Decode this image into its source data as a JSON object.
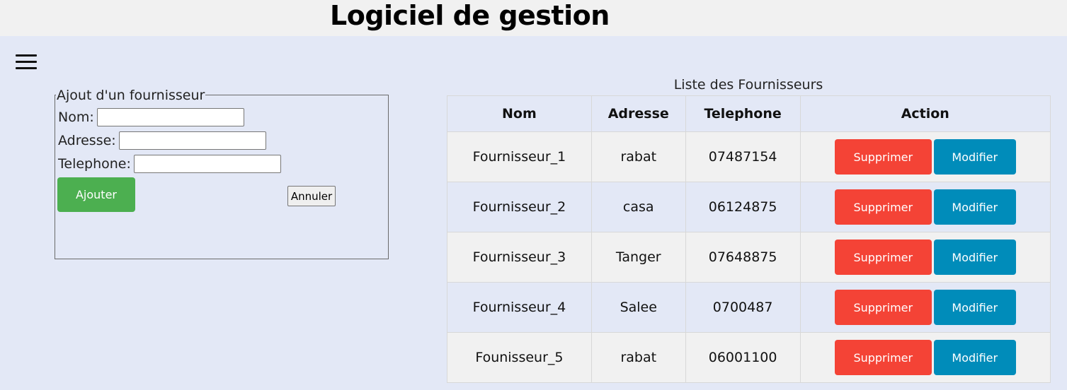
{
  "header": {
    "title": "Logiciel de gestion"
  },
  "menu": {
    "icon": "hamburger-menu-icon"
  },
  "form": {
    "legend": "Ajout d'un fournisseur",
    "fields": [
      {
        "label": "Nom:",
        "value": "",
        "placeholder": ""
      },
      {
        "label": "Adresse:",
        "value": "",
        "placeholder": ""
      },
      {
        "label": "Telephone:",
        "value": "",
        "placeholder": ""
      }
    ],
    "submit_label": "Ajouter",
    "cancel_label": "Annuler"
  },
  "table": {
    "caption": "Liste des Fournisseurs",
    "columns": [
      "Nom",
      "Adresse",
      "Telephone",
      "Action"
    ],
    "rows": [
      {
        "nom": "Fournisseur_1",
        "adresse": "rabat",
        "telephone": "07487154"
      },
      {
        "nom": "Fournisseur_2",
        "adresse": "casa",
        "telephone": "06124875"
      },
      {
        "nom": "Fournisseur_3",
        "adresse": "Tanger",
        "telephone": "07648875"
      },
      {
        "nom": "Fournisseur_4",
        "adresse": "Salee",
        "telephone": "0700487"
      },
      {
        "nom": "Founisseur_5",
        "adresse": "rabat",
        "telephone": "06001100"
      }
    ],
    "delete_label": "Supprimer",
    "edit_label": "Modifier"
  },
  "colors": {
    "background": "#e3e8f6",
    "topbar": "#f1f1f1",
    "add_button": "#4caf50",
    "delete_button": "#f44336",
    "edit_button": "#008cba"
  }
}
